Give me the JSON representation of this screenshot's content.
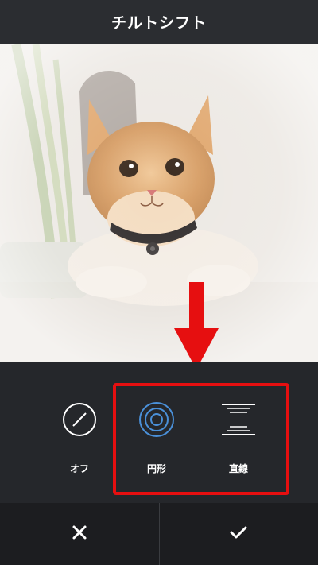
{
  "header": {
    "title": "チルトシフト"
  },
  "tools": [
    {
      "label": "オフ",
      "icon": "off-slash-icon"
    },
    {
      "label": "円形",
      "icon": "radial-circles-icon",
      "active_color": "#4a90d9"
    },
    {
      "label": "直線",
      "icon": "linear-lines-icon"
    }
  ],
  "footer": {
    "cancel_icon": "close-icon",
    "confirm_icon": "checkmark-icon"
  },
  "annotation": {
    "color": "#e60f10"
  }
}
